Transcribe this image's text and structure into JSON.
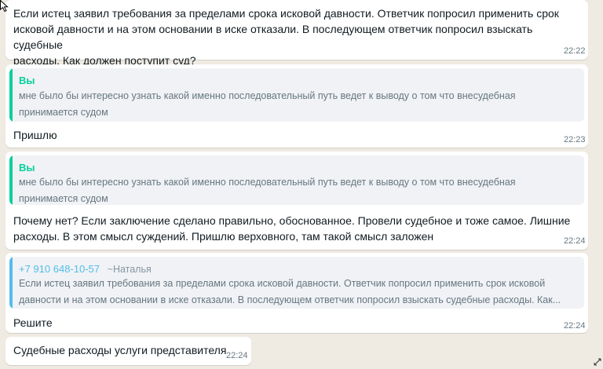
{
  "colors": {
    "background": "#efeae2",
    "bubble": "#ffffff",
    "quote_bg": "#f0f2f5",
    "quote_bar_you": "#06cf9c",
    "quote_bar_contact": "#53bdeb",
    "author_you": "#06cf9c",
    "author_contact": "#53bdeb"
  },
  "messages": [
    {
      "text": "Если истец заявил требования за пределами срока исковой давности. Ответчик попросил применить срок\nисковой давности и на этом основании в иске отказали. В последующем ответчик попросил взыскать судебные\nрасходы. Как должен поступит суд?",
      "time": "22:22"
    },
    {
      "quote_author": "Вы",
      "quote_text": "мне было бы интересно узнать какой именно последовательный путь ведет к выводу о том что внесудебная\nпринимается судом",
      "text": "Пришлю",
      "time": "22:23"
    },
    {
      "quote_author": "Вы",
      "quote_text": "мне было бы интересно узнать какой именно последовательный путь ведет к выводу о том что внесудебная\nпринимается судом",
      "text": "Почему нет? Если заключение сделано правильно, обоснованное. Провели судебное и тоже самое. Лишние\nрасходы. В этом смысл суждений. Пришлю верховного, там такой смысл заложен",
      "time": "22:24"
    },
    {
      "quote_author": "+7 910 648-10-57",
      "quote_author_name": "~Наталья",
      "quote_text": "Если истец заявил требования за пределами срока исковой давности. Ответчик попросил применить срок исковой\nдавности и на этом основании в иске отказали. В последующем ответчик попросил взыскать судебные расходы. Как...",
      "text": "Решите",
      "time": "22:24"
    },
    {
      "text": "Судебные расходы услуги представителя",
      "time": "22:24"
    }
  ],
  "icons": {
    "cursor": "mouse-pointer-icon",
    "scroll": "resize-arrows-icon"
  }
}
